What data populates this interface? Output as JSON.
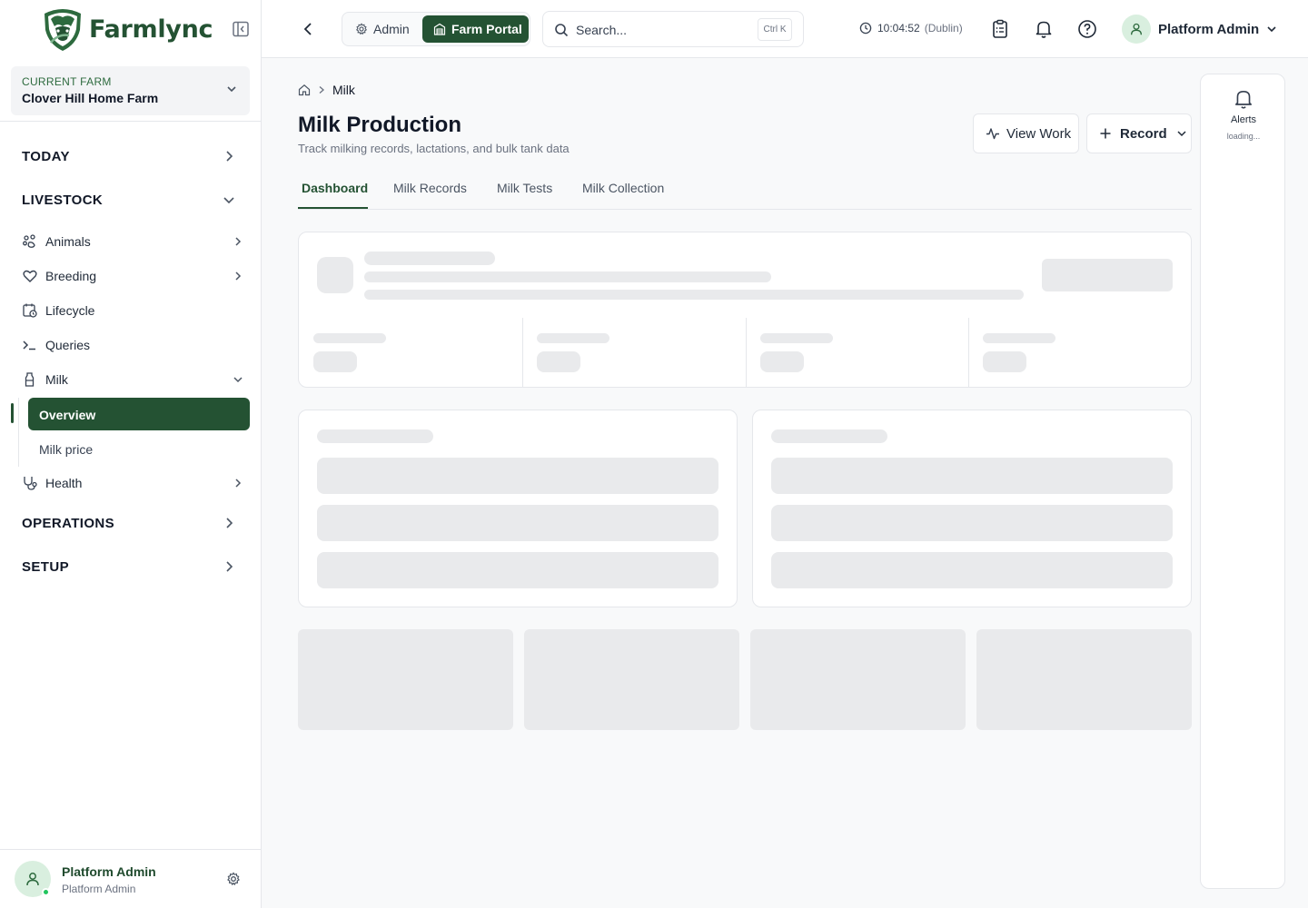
{
  "brand": {
    "name": "Farmlync",
    "color": "#245233"
  },
  "farm": {
    "label": "CURRENT FARM",
    "name": "Clover Hill Home Farm"
  },
  "sidebar": {
    "sections": [
      {
        "label": "TODAY"
      },
      {
        "label": "LIVESTOCK"
      },
      {
        "label": "OPERATIONS"
      },
      {
        "label": "SETUP"
      }
    ],
    "items": [
      {
        "label": "Animals",
        "icon": "paw-icon"
      },
      {
        "label": "Breeding",
        "icon": "heart-icon"
      },
      {
        "label": "Lifecycle",
        "icon": "calendar-clock-icon"
      },
      {
        "label": "Queries",
        "icon": "terminal-icon"
      },
      {
        "label": "Milk",
        "icon": "milk-bottle-icon"
      },
      {
        "label": "Health",
        "icon": "stethoscope-icon"
      }
    ],
    "milk_sub": [
      {
        "label": "Overview",
        "active": true
      },
      {
        "label": "Milk price",
        "active": false
      }
    ],
    "footer": {
      "name": "Platform Admin",
      "role": "Platform Admin"
    }
  },
  "topbar": {
    "switch": {
      "admin": "Admin",
      "farm_portal": "Farm Portal"
    },
    "search": {
      "placeholder": "Search...",
      "shortcut": "Ctrl K"
    },
    "clock": {
      "time": "10:04:52",
      "timezone": "(Dublin)"
    },
    "user": {
      "name": "Platform Admin"
    }
  },
  "page": {
    "breadcrumb": {
      "current": "Milk"
    },
    "title": "Milk Production",
    "subtitle": "Track milking records, lactations, and bulk tank data",
    "actions": {
      "view_work": "View Work",
      "record": "Record"
    },
    "tabs": [
      {
        "label": "Dashboard",
        "active": true
      },
      {
        "label": "Milk Records",
        "active": false
      },
      {
        "label": "Milk Tests",
        "active": false
      },
      {
        "label": "Milk Collection",
        "active": false
      }
    ]
  },
  "alerts": {
    "label": "Alerts",
    "status": "loading..."
  }
}
